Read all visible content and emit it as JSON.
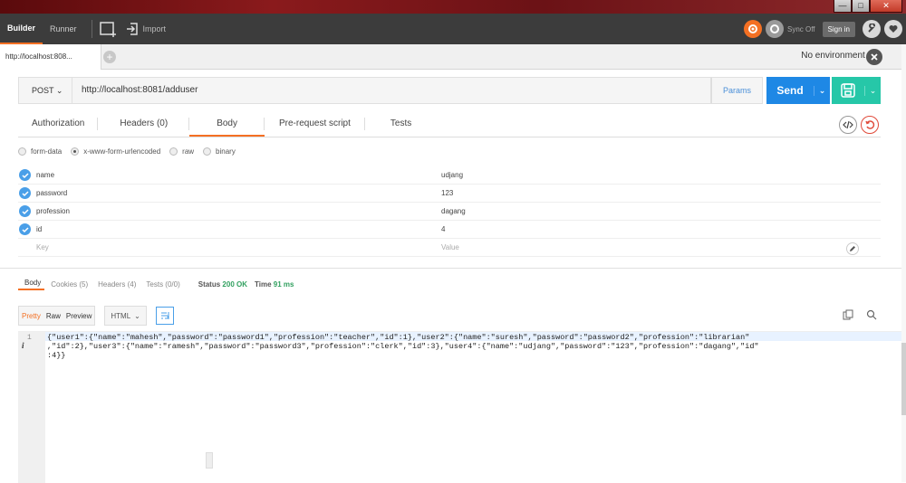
{
  "window": {
    "min": "—",
    "max": "□",
    "close": "✕"
  },
  "appbar": {
    "modes": [
      "Builder",
      "Runner"
    ],
    "import_label": "Import",
    "sync_label": "Sync Off",
    "signin_label": "Sign in"
  },
  "tabs": {
    "request_tab": "http://localhost:808...",
    "add_tab": "+",
    "environment": "No environment"
  },
  "request": {
    "method": "POST",
    "url": "http://localhost:8081/adduser",
    "params_label": "Params",
    "send_label": "Send"
  },
  "subtabs": [
    "Authorization",
    "Headers (0)",
    "Body",
    "Pre-request script",
    "Tests"
  ],
  "body_types": [
    {
      "label": "form-data",
      "selected": false
    },
    {
      "label": "x-www-form-urlencoded",
      "selected": true
    },
    {
      "label": "raw",
      "selected": false
    },
    {
      "label": "binary",
      "selected": false
    }
  ],
  "form_rows": [
    {
      "key": "name",
      "value": "udjang"
    },
    {
      "key": "password",
      "value": "123"
    },
    {
      "key": "profession",
      "value": "dagang"
    },
    {
      "key": "id",
      "value": "4"
    }
  ],
  "form_placeholder": {
    "key": "Key",
    "value": "Value"
  },
  "response": {
    "tabs": [
      "Body",
      "Cookies (5)",
      "Headers (4)",
      "Tests (0/0)"
    ],
    "status_label": "Status",
    "status_value": "200 OK",
    "time_label": "Time",
    "time_value": "91 ms",
    "formats": [
      "Pretty",
      "Raw",
      "Preview"
    ],
    "language": "HTML",
    "line_number": "1",
    "info_marker": "i",
    "body": "{\"user1\":{\"name\":\"mahesh\",\"password\":\"password1\",\"profession\":\"teacher\",\"id\":1},\"user2\":{\"name\":\"suresh\",\"password\":\"password2\",\"profession\":\"librarian\"\n,\"id\":2},\"user3\":{\"name\":\"ramesh\",\"password\":\"password3\",\"profession\":\"clerk\",\"id\":3},\"user4\":{\"name\":\"udjang\",\"password\":\"123\",\"profession\":\"dagang\",\"id\"\n:4}}"
  },
  "colors": {
    "accent": "#f47023",
    "send": "#1e88e5",
    "save": "#26c7a8",
    "status_ok": "#31a05f",
    "check": "#4a9fe8"
  }
}
